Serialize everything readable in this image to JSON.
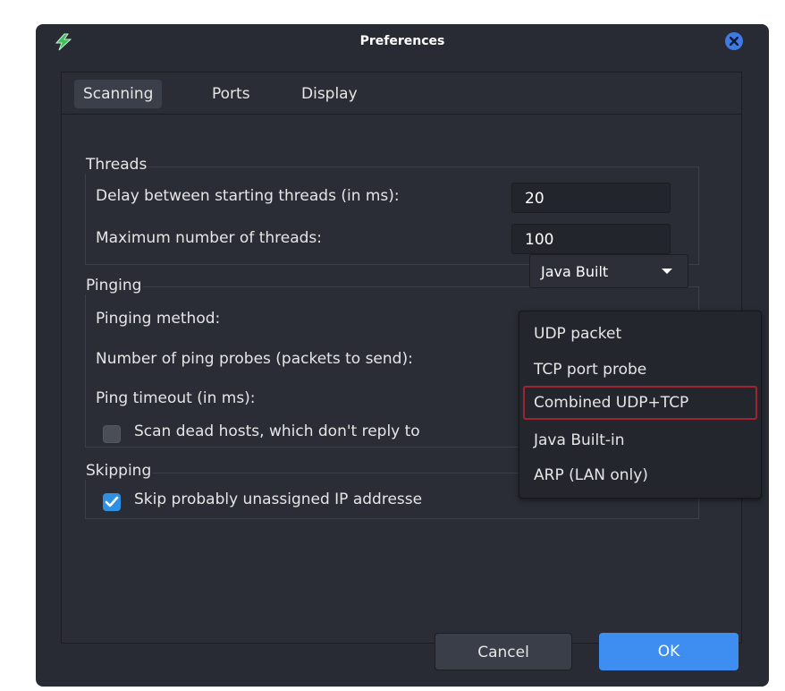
{
  "window": {
    "title": "Preferences"
  },
  "tabs": [
    "Scanning",
    "Ports",
    "Display"
  ],
  "threads": {
    "legend": "Threads",
    "delay_label": "Delay between starting threads (in ms):",
    "delay_value": "20",
    "max_label": "Maximum number of threads:",
    "max_value": "100"
  },
  "pinging": {
    "legend": "Pinging",
    "method_label": "Pinging method:",
    "method_value": "Java Built",
    "probes_label": "Number of ping probes (packets to send):",
    "timeout_label": "Ping timeout (in ms):",
    "scan_dead_label": "Scan dead hosts, which don't reply to",
    "scan_dead_checked": false
  },
  "skipping": {
    "legend": "Skipping",
    "skip_label": "Skip probably unassigned IP addresse",
    "skip_checked": true
  },
  "dropdown": {
    "options": [
      "UDP packet",
      "TCP port probe",
      "Combined UDP+TCP",
      "Java Built-in",
      "ARP (LAN only)"
    ],
    "highlighted": "Combined UDP+TCP"
  },
  "buttons": {
    "cancel": "Cancel",
    "ok": "OK"
  },
  "colors": {
    "accent": "#3d8ef0",
    "highlight_border": "#a02530",
    "background": "#282b33"
  },
  "icons": {
    "app": "lightning-icon",
    "close": "close-icon",
    "caret": "chevron-down-icon",
    "check": "check-icon"
  }
}
